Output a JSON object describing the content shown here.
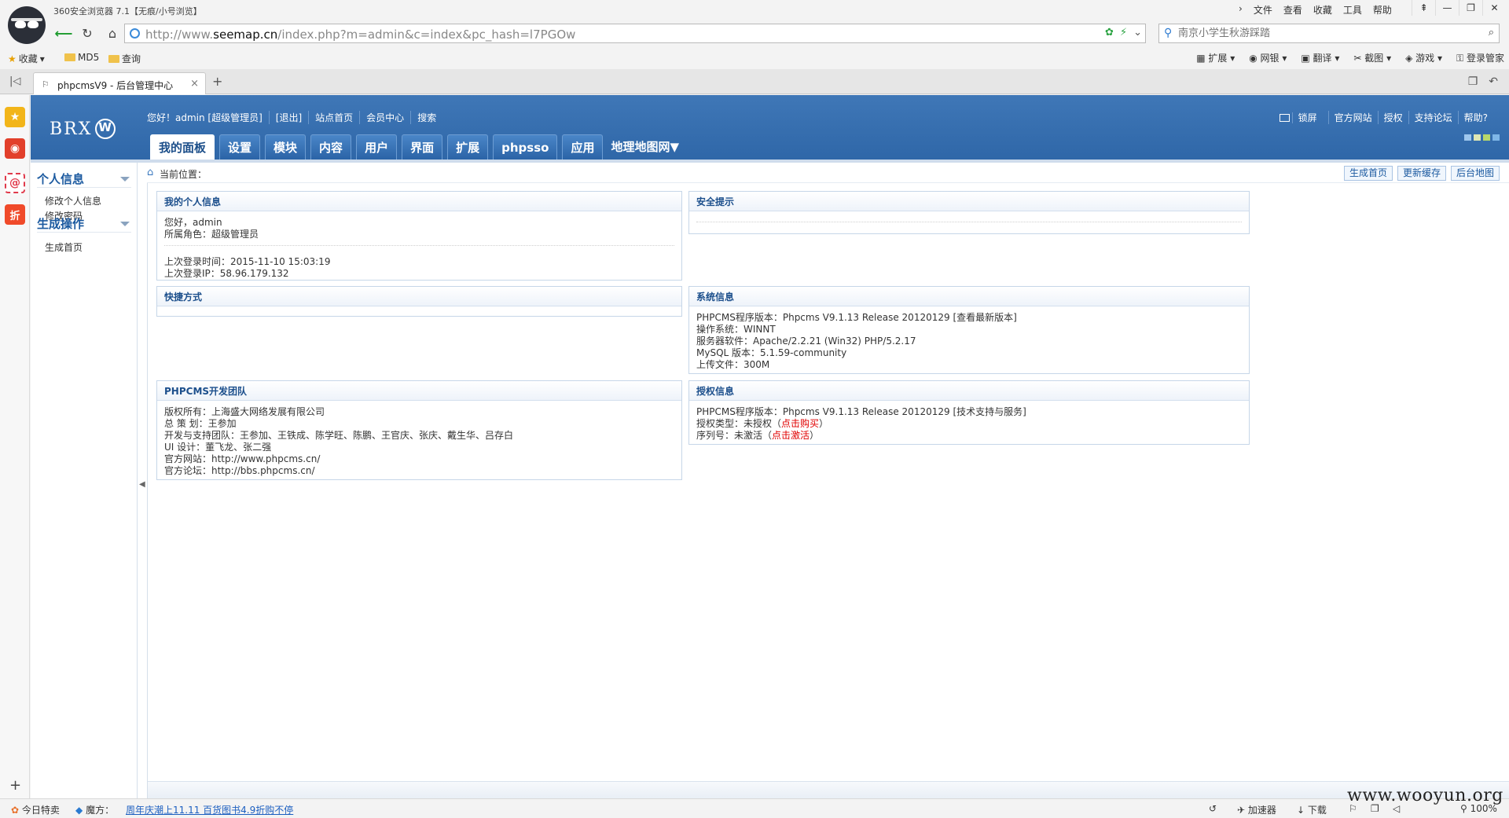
{
  "browser": {
    "title": "360安全浏览器 7.1【无痕/小号浏览】",
    "menu": [
      "文件",
      "查看",
      "收藏",
      "工具",
      "帮助"
    ],
    "window_controls": [
      "⇞",
      "—",
      "❐",
      "✕"
    ],
    "address": {
      "prefix": "http://www.",
      "domain": "seemap.cn",
      "path": "/index.php?m=admin&c=index&pc_hash=l7PGOw"
    },
    "search_placeholder": "南京小学生秋游踩踏",
    "bookmarks": [
      "收藏",
      "MD5",
      "查询"
    ],
    "extensions": [
      "扩展",
      "网银",
      "翻译",
      "截图",
      "游戏",
      "登录管家"
    ],
    "tab_title": "phpcmsV9 - 后台管理中心",
    "status": {
      "daily_deals": "今日特卖",
      "magic_label": "魔方：",
      "promo_link": "周年庆潮上11.11 百货图书4.9折购不停",
      "accelerator": "加速器",
      "download": "下载",
      "zoom": "100%"
    },
    "watermark": "www.wooyun.org"
  },
  "cms": {
    "logo_text": "BRX",
    "user_links": [
      "您好！admin [超级管理员]",
      "[退出]",
      "站点首页",
      "会员中心",
      "搜索"
    ],
    "right_links": [
      "锁屏",
      "官方网站",
      "授权",
      "支持论坛",
      "帮助?"
    ],
    "skin_colors": [
      "#9ec7ee",
      "#dfe7b4",
      "#b8d86a",
      "#7fb7e8"
    ],
    "nav_tabs": [
      "我的面板",
      "设置",
      "模块",
      "内容",
      "用户",
      "界面",
      "扩展",
      "phpsso",
      "应用"
    ],
    "site_dropdown": "地理地图网",
    "sidebar": {
      "section1": "个人信息",
      "items1": [
        "修改个人信息",
        "修改密码"
      ],
      "section2": "生成操作",
      "items2": [
        "生成首页"
      ]
    },
    "breadcrumb_label": "当前位置：",
    "crumb_buttons": [
      "生成首页",
      "更新缓存",
      "后台地图"
    ],
    "panels": {
      "profile": {
        "title": "我的个人信息",
        "greeting": "您好，admin",
        "role": "所属角色：超级管理员",
        "last_login_time": "上次登录时间：2015-11-10 15:03:19",
        "last_login_ip": "上次登录IP：58.96.179.132"
      },
      "security": {
        "title": "安全提示"
      },
      "shortcuts": {
        "title": "快捷方式"
      },
      "sysinfo": {
        "title": "系统信息",
        "lines": [
          "PHPCMS程序版本：Phpcms V9.1.13 Release 20120129 [查看最新版本]",
          "操作系统：WINNT",
          "服务器软件：Apache/2.2.21 (Win32) PHP/5.2.17",
          "MySQL 版本：5.1.59-community",
          "上传文件：300M"
        ]
      },
      "team": {
        "title": "PHPCMS开发团队",
        "lines": [
          "版权所有：上海盛大网络发展有限公司",
          "总 策 划：王参加",
          "开发与支持团队：王参加、王铁成、陈学旺、陈鹏、王官庆、张庆、戴生华、吕存白",
          "UI 设计：董飞龙、张二强",
          "官方网站：http://www.phpcms.cn/",
          "官方论坛：http://bbs.phpcms.cn/"
        ]
      },
      "license": {
        "title": "授权信息",
        "version": "PHPCMS程序版本：Phpcms V9.1.13 Release 20120129 [技术支持与服务]",
        "type_prefix": "授权类型：未授权（",
        "type_link": "点击购买",
        "type_suffix": "）",
        "serial_prefix": "序列号：未激活（",
        "serial_link": "点击激活",
        "serial_suffix": "）"
      }
    }
  }
}
